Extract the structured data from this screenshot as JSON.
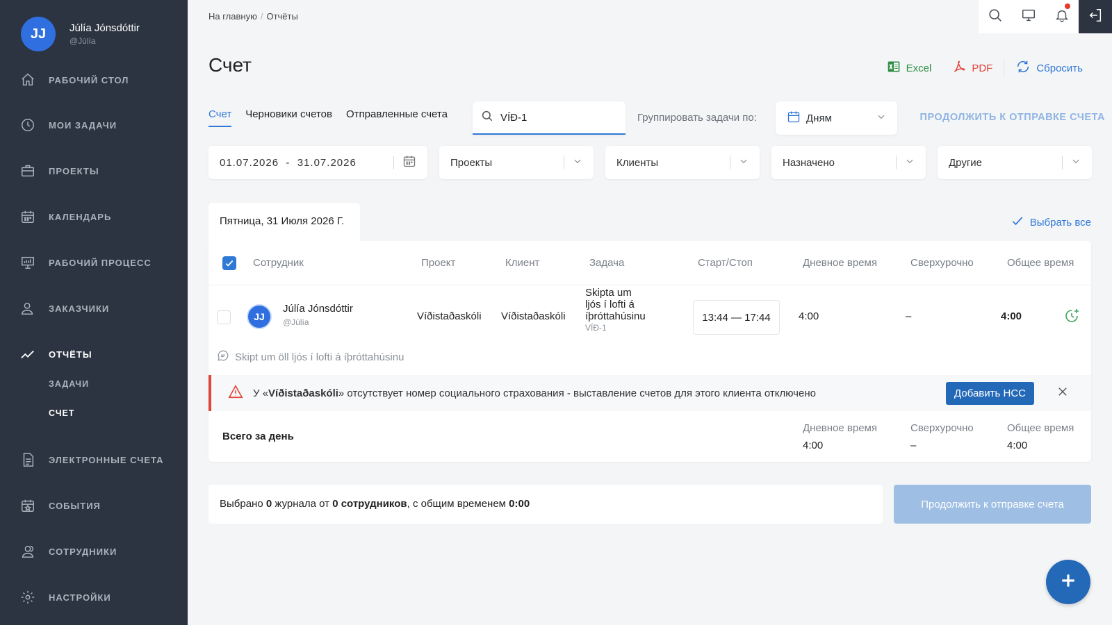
{
  "user": {
    "initials": "JJ",
    "name": "Júlía Jónsdóttir",
    "handle": "@Júlía"
  },
  "sidebar": {
    "items": [
      {
        "label": "РАБОЧИЙ СТОЛ",
        "icon": "home-icon"
      },
      {
        "label": "МОИ ЗАДАЧИ",
        "icon": "clock-icon"
      },
      {
        "label": "ПРОЕКТЫ",
        "icon": "briefcase-icon"
      },
      {
        "label": "КАЛЕНДАРЬ",
        "icon": "calendar-icon"
      },
      {
        "label": "РАБОЧИЙ ПРОЦЕСС",
        "icon": "presentation-icon"
      },
      {
        "label": "ЗАКАЗЧИКИ",
        "icon": "user-icon"
      },
      {
        "label": "ОТЧЁТЫ",
        "icon": "trend-icon"
      },
      {
        "label": "ЭЛЕКТРОННЫЕ СЧЕТА",
        "icon": "document-icon"
      },
      {
        "label": "СОБЫТИЯ",
        "icon": "calendar-star-icon"
      },
      {
        "label": "СОТРУДНИКИ",
        "icon": "users-icon"
      },
      {
        "label": "НАСТРОЙКИ",
        "icon": "gear-icon"
      }
    ],
    "sub_items": [
      "ЗАДАЧИ",
      "СЧЕТ"
    ]
  },
  "breadcrumb": {
    "home": "На главную",
    "sep": "/",
    "current": "Отчёты"
  },
  "page": {
    "title": "Счет"
  },
  "actions": {
    "excel": "Excel",
    "pdf": "PDF",
    "reset": "Сбросить"
  },
  "tabs": [
    "Счет",
    "Черновики счетов",
    "Отправленные счета"
  ],
  "search": {
    "value": "VÍÐ-1"
  },
  "group": {
    "label": "Группировать задачи по:",
    "value": "Дням"
  },
  "continue_link": "ПРОДОЛЖИТЬ К ОТПРАВКЕ СЧЕТА",
  "filters": {
    "date_range": "01.07.2026  -  31.07.2026",
    "projects": "Проекты",
    "clients": "Клиенты",
    "assigned": "Назначено",
    "other": "Другие"
  },
  "day": {
    "title": "Пятница, 31 Июля 2026 Г.",
    "select_all": "Выбрать все"
  },
  "table": {
    "headers": [
      "Сотрудник",
      "Проект",
      "Клиент",
      "Задача",
      "Старт/Стоп",
      "Дневное время",
      "Сверхурочно",
      "Общее время"
    ],
    "row": {
      "employee_initials": "JJ",
      "employee_name": "Júlía Jónsdóttir",
      "employee_handle": "@Júlía",
      "project": "Víðistaðaskóli",
      "client": "Víðistaðaskóli",
      "task_line1": "Skipta um",
      "task_line2": "ljós í lofti á",
      "task_line3": "íþróttahúsinu",
      "task_code": "VÍÐ-1",
      "start_stop": "13:44 — 17:44",
      "day_time": "4:00",
      "overtime": "–",
      "total": "4:00",
      "comment": "Skipt um öll ljós í lofti á íþróttahúsinu"
    }
  },
  "alert": {
    "prefix": "У «",
    "client": "Víðistaðaskóli",
    "suffix": "» отсутствует номер социального страхования - выставление счетов для этого клиента отключено",
    "button": "Добавить НСС"
  },
  "totals": {
    "label": "Всего за день",
    "day_time_label": "Дневное время",
    "day_time": "4:00",
    "overtime_label": "Сверхурочно",
    "overtime": "–",
    "total_label": "Общее время",
    "total": "4:00"
  },
  "summary": {
    "t1": "Выбрано ",
    "logs": "0",
    "t2": " журнала от ",
    "employees": "0 сотрудников",
    "t3": ", с общим временем ",
    "time": "0:00"
  },
  "continue_button": "Продолжить к отправке счета",
  "colors": {
    "accent": "#2f78d6",
    "sidebar": "#2b3440",
    "danger": "#e2453a",
    "excel": "#2f8f46"
  }
}
